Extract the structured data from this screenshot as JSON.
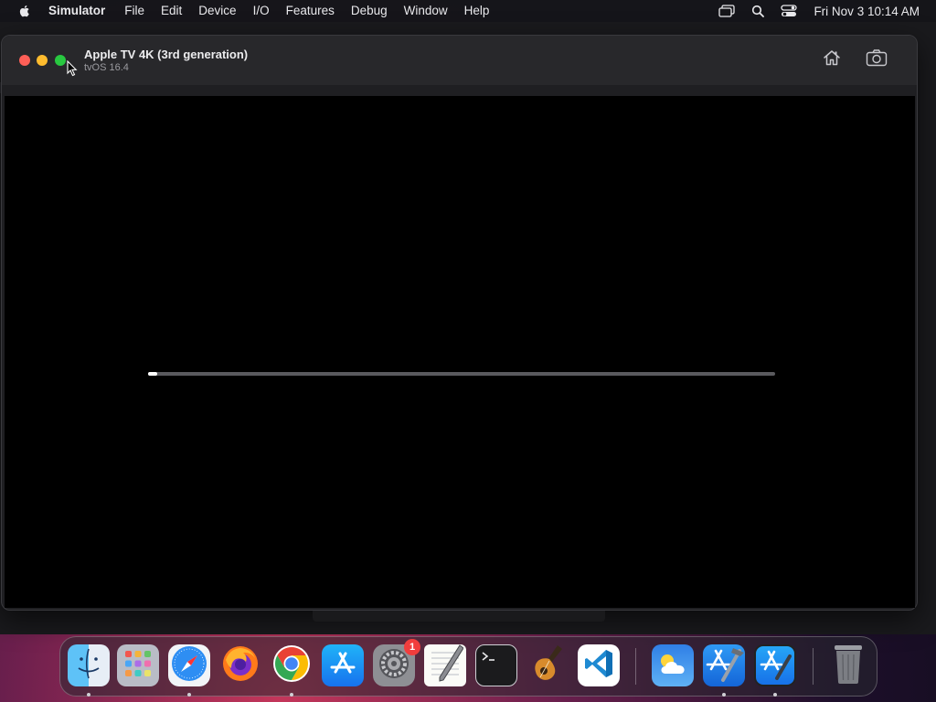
{
  "menubar": {
    "app_name": "Simulator",
    "items": [
      "File",
      "Edit",
      "Device",
      "I/O",
      "Features",
      "Debug",
      "Window",
      "Help"
    ],
    "clock": "Fri Nov 3  10:14 AM"
  },
  "simulator": {
    "device_name": "Apple TV 4K (3rd generation)",
    "os_version": "tvOS 16.4",
    "boot_progress": 0.015
  },
  "dock": {
    "apps": [
      {
        "name": "Finder",
        "icon": "finder-icon",
        "running": true
      },
      {
        "name": "Launchpad",
        "icon": "launchpad-icon",
        "running": false
      },
      {
        "name": "Safari",
        "icon": "safari-icon",
        "running": true
      },
      {
        "name": "Firefox",
        "icon": "firefox-icon",
        "running": false
      },
      {
        "name": "Chrome",
        "icon": "chrome-icon",
        "running": true
      },
      {
        "name": "App Store",
        "icon": "app-store-icon",
        "running": false
      },
      {
        "name": "System Settings",
        "icon": "system-settings-icon",
        "running": false,
        "badge": "1"
      },
      {
        "name": "TextEdit",
        "icon": "textedit-icon",
        "running": false
      },
      {
        "name": "Terminal",
        "icon": "terminal-icon",
        "running": false
      },
      {
        "name": "GarageBand",
        "icon": "garageband-icon",
        "running": false
      },
      {
        "name": "Visual Studio Code",
        "icon": "vscode-icon",
        "running": false
      },
      {
        "name": "Weather",
        "icon": "weather-icon",
        "running": false
      },
      {
        "name": "Xcode",
        "icon": "xcode-icon",
        "running": true
      },
      {
        "name": "Simulator",
        "icon": "simulator-icon",
        "running": true
      },
      {
        "name": "Trash",
        "icon": "trash-icon",
        "running": false
      }
    ]
  }
}
